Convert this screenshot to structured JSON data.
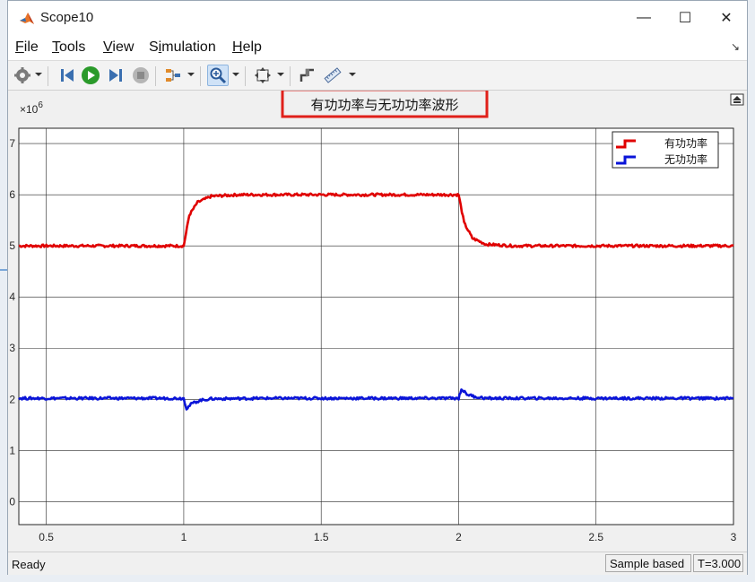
{
  "window": {
    "title": "Scope10"
  },
  "window_controls": {
    "minimize": "—",
    "maximize": "☐",
    "close": "✕"
  },
  "menu": [
    {
      "label": "File",
      "key": "F",
      "rest": "ile"
    },
    {
      "label": "Tools",
      "key": "T",
      "rest": "ools"
    },
    {
      "label": "View",
      "key": "V",
      "rest": "iew"
    },
    {
      "label": "Simulation",
      "key": "i",
      "pre": "S",
      "rest": "mulation"
    },
    {
      "label": "Help",
      "key": "H",
      "rest": "elp"
    }
  ],
  "toolbar": {
    "icons": [
      "gear-icon",
      "step-back-icon",
      "run-icon",
      "step-forward-icon",
      "stop-icon",
      "signal-select-icon",
      "zoom-icon",
      "fit-view-icon",
      "cursor-measure-icon",
      "ruler-icon"
    ]
  },
  "colors": {
    "active_power": "#e00000",
    "reactive_power": "#0a14d8",
    "annotation_box": "#e0201a",
    "plot_bg": "#ffffff"
  },
  "status": {
    "state": "Ready",
    "mode": "Sample based",
    "time": "T=3.000"
  },
  "chart_data": {
    "type": "line",
    "title": "有功功率与无功功率波形",
    "exponent_label": "×10",
    "exponent_power": "6",
    "xlim": [
      0.4,
      3.0
    ],
    "ylim": [
      -0.45,
      7.3
    ],
    "x_ticks": [
      "0.5",
      "1",
      "1.5",
      "2",
      "2.5",
      "3"
    ],
    "x_tick_values": [
      0.5,
      1,
      1.5,
      2,
      2.5,
      3
    ],
    "y_ticks": [
      "0",
      "1",
      "2",
      "3",
      "4",
      "5",
      "6",
      "7"
    ],
    "y_tick_values": [
      0,
      1,
      2,
      3,
      4,
      5,
      6,
      7
    ],
    "grid": true,
    "legend_position": "top-right",
    "series": [
      {
        "name": "有功功率",
        "color": "#e00000",
        "x": [
          0.4,
          0.99,
          1.0,
          1.02,
          1.05,
          1.1,
          1.2,
          1.4,
          1.6,
          1.8,
          1.99,
          2.0,
          2.02,
          2.05,
          2.1,
          2.2,
          2.4,
          2.6,
          2.8,
          3.0
        ],
        "y": [
          5.0,
          5.0,
          5.0,
          5.6,
          5.85,
          5.97,
          6.0,
          6.0,
          6.0,
          6.0,
          6.0,
          6.0,
          5.45,
          5.15,
          5.03,
          5.0,
          5.0,
          5.0,
          5.0,
          5.0
        ]
      },
      {
        "name": "无功功率",
        "color": "#0a14d8",
        "x": [
          0.4,
          0.99,
          1.0,
          1.01,
          1.03,
          1.06,
          1.1,
          1.3,
          1.6,
          1.99,
          2.0,
          2.01,
          2.03,
          2.06,
          2.1,
          2.4,
          2.7,
          3.0
        ],
        "y": [
          2.02,
          2.02,
          2.02,
          1.82,
          1.92,
          1.98,
          2.01,
          2.02,
          2.02,
          2.02,
          2.02,
          2.2,
          2.1,
          2.05,
          2.02,
          2.02,
          2.02,
          2.02
        ]
      }
    ]
  }
}
